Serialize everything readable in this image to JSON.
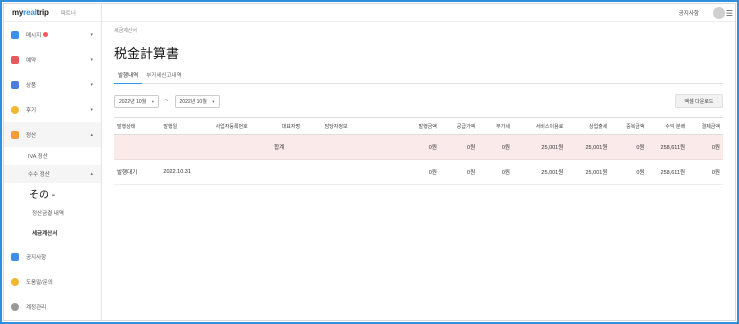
{
  "app": {
    "logo_prefix": "my",
    "logo_accent": "real",
    "logo_suffix": "trip",
    "partner": "파트너"
  },
  "sidebar": {
    "items": [
      {
        "label": "메시지",
        "icon": "message-icon",
        "color": "#3d8ee8"
      },
      {
        "label": "예약",
        "icon": "calendar-icon",
        "color": "#e85a5a"
      },
      {
        "label": "상품",
        "icon": "grid-icon",
        "color": "#4a7ddb"
      },
      {
        "label": "후기",
        "icon": "star-icon",
        "color": "#f2b632"
      },
      {
        "label": "정산",
        "icon": "settlement-icon",
        "color": "#f29d38"
      }
    ],
    "sub_items": [
      {
        "label": "IVA 정산"
      },
      {
        "label": "수수 정산"
      },
      {
        "label": "その -"
      },
      {
        "label": "정산금결 내역"
      },
      {
        "label": "세금계산서"
      }
    ],
    "bottom_items": [
      {
        "label": "공지사항",
        "icon": "megaphone-icon",
        "color": "#3d8ee8"
      },
      {
        "label": "도움말/문의",
        "icon": "help-icon",
        "color": "#f2b632"
      },
      {
        "label": "계정관리",
        "icon": "gear-icon",
        "color": "#999999"
      }
    ]
  },
  "header": {
    "notice": "공지사항",
    "menu_glyph": "☰"
  },
  "main": {
    "breadcrumb": "세금계산서",
    "title": "税金計算書",
    "tabs": [
      "발행내역",
      "부가세신고내역"
    ],
    "filters": {
      "from": "2022년 10월",
      "tilde": "~",
      "to": "2022년 10월",
      "excel": "엑셀 다운로드"
    },
    "table": {
      "headers": [
        "발행상태",
        "발행일",
        "사업자등록번호",
        "대표자명",
        "담당자정보",
        "발행금액",
        "공급가액",
        "부가세",
        "서비스이용료",
        "상업출세",
        "중복금액",
        "수익 분배",
        "결제금액"
      ],
      "summary": {
        "label": "합계",
        "values": [
          "0원",
          "0원",
          "0원",
          "25,001원",
          "25,001원",
          "0원",
          "258,611원",
          "0원"
        ]
      },
      "rows": [
        {
          "status": "발행대기",
          "date": "2022.10.31",
          "values": [
            "0원",
            "0원",
            "0원",
            "25,001원",
            "25,001원",
            "0원",
            "258,611원",
            "0원"
          ]
        }
      ]
    }
  }
}
